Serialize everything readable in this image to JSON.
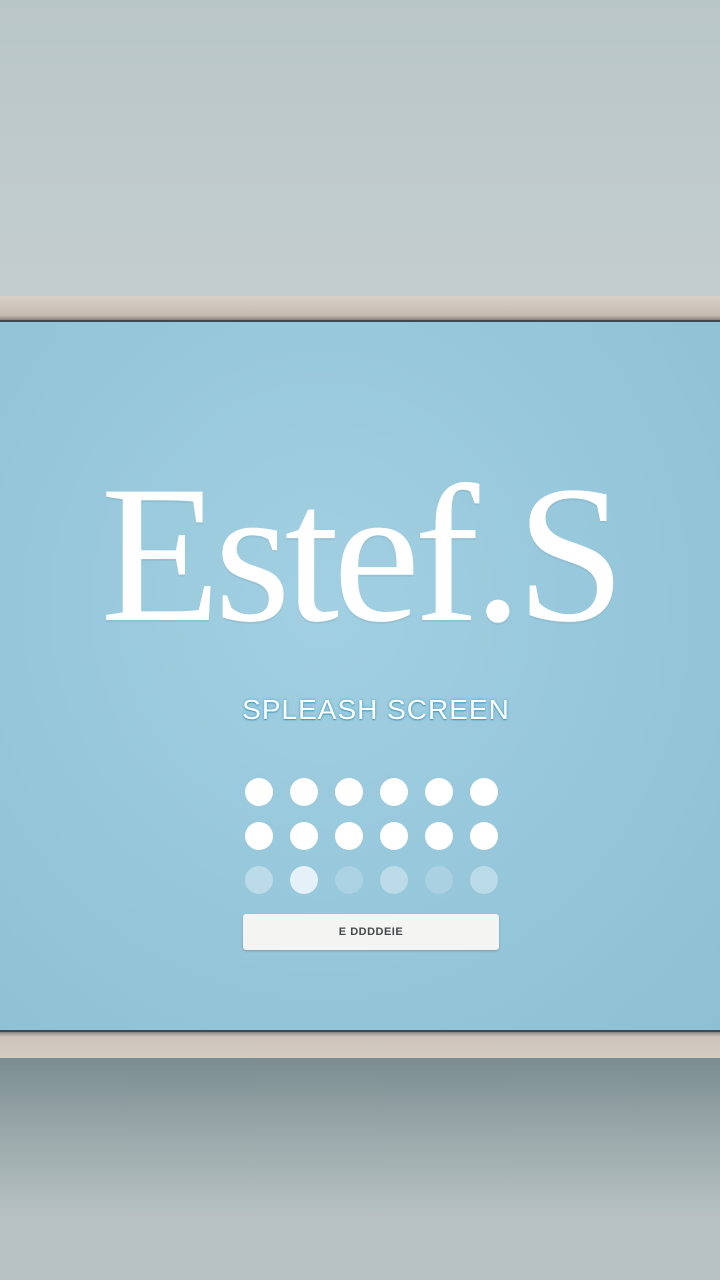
{
  "app": {
    "brand": "Estef.S",
    "subtitle": "SPLEASH SCREEN"
  },
  "loader": {
    "indicator": "loading-dots"
  },
  "action": {
    "button_label": "E DDDDEIE"
  },
  "colors": {
    "screen": "#98c8dc",
    "frame": "#d3c9c0",
    "wall": "#c0cbcd",
    "text": "#ffffff",
    "button": "#f4f4f2"
  }
}
